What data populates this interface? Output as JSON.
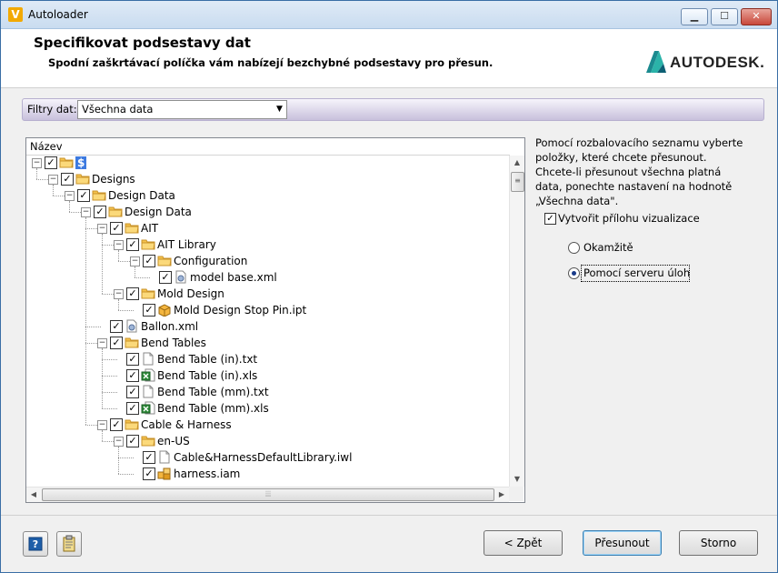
{
  "window": {
    "title": "Autoloader",
    "minimize": "▁",
    "maximize": "☐",
    "close": "✕"
  },
  "header": {
    "title": "Specifikovat podsestavy dat",
    "subtitle": "Spodní zaškrtávací políčka vám nabízejí bezchybné podsestavy pro přesun.",
    "logo_text": "AUTODESK."
  },
  "filter": {
    "label": "Filtry dat:",
    "value": "Všechna data"
  },
  "tree": {
    "column_header": "Název",
    "rows": [
      {
        "label": "$",
        "depth": 0,
        "icon": "folder-icon",
        "expander": "minus"
      },
      {
        "label": "Designs",
        "depth": 1,
        "icon": "folder-icon",
        "expander": "minus"
      },
      {
        "label": "Design Data",
        "depth": 2,
        "icon": "folder-icon",
        "expander": "minus"
      },
      {
        "label": "Design Data",
        "depth": 3,
        "icon": "folder-icon",
        "expander": "minus"
      },
      {
        "label": "AIT",
        "depth": 4,
        "icon": "folder-icon",
        "expander": "minus"
      },
      {
        "label": "AIT Library",
        "depth": 5,
        "icon": "folder-icon",
        "expander": "minus"
      },
      {
        "label": "Configuration",
        "depth": 6,
        "icon": "folder-icon",
        "expander": "minus"
      },
      {
        "label": "model base.xml",
        "depth": 7,
        "icon": "xml-file-icon",
        "expander": "none"
      },
      {
        "label": "Mold Design",
        "depth": 5,
        "icon": "folder-icon",
        "expander": "minus"
      },
      {
        "label": "Mold Design Stop Pin.ipt",
        "depth": 6,
        "icon": "part-file-icon",
        "expander": "none"
      },
      {
        "label": "Ballon.xml",
        "depth": 4,
        "icon": "xml-file-icon",
        "expander": "none"
      },
      {
        "label": "Bend Tables",
        "depth": 4,
        "icon": "folder-icon",
        "expander": "minus"
      },
      {
        "label": "Bend Table (in).txt",
        "depth": 5,
        "icon": "text-file-icon",
        "expander": "none"
      },
      {
        "label": "Bend Table (in).xls",
        "depth": 5,
        "icon": "excel-file-icon",
        "expander": "none"
      },
      {
        "label": "Bend Table (mm).txt",
        "depth": 5,
        "icon": "text-file-icon",
        "expander": "none"
      },
      {
        "label": "Bend Table (mm).xls",
        "depth": 5,
        "icon": "excel-file-icon",
        "expander": "none"
      },
      {
        "label": "Cable & Harness",
        "depth": 4,
        "icon": "folder-icon",
        "expander": "minus"
      },
      {
        "label": "en-US",
        "depth": 5,
        "icon": "folder-icon",
        "expander": "minus"
      },
      {
        "label": "Cable&HarnessDefaultLibrary.iwl",
        "depth": 6,
        "icon": "text-file-icon",
        "expander": "none"
      },
      {
        "label": "harness.iam",
        "depth": 6,
        "icon": "assembly-file-icon",
        "expander": "none"
      }
    ]
  },
  "info": {
    "text": "Pomocí rozbalovacího seznamu vyberte položky, které chcete přesunout. Chcete-li přesunout všechna platná data, ponechte nastavení na hodnotě „Všechna data\"."
  },
  "options": {
    "attachment_label": "Vytvořit přílohu vizualizace",
    "attachment_checked": true,
    "radio_immediate": "Okamžitě",
    "radio_server": "Pomocí serveru úloh",
    "selected": "server"
  },
  "buttons": {
    "back": "< Zpět",
    "move": "Přesunout",
    "cancel": "Storno",
    "help_glyph": "?"
  },
  "colors": {
    "folder": "#f5c24c",
    "accent": "#3a6ea5"
  }
}
